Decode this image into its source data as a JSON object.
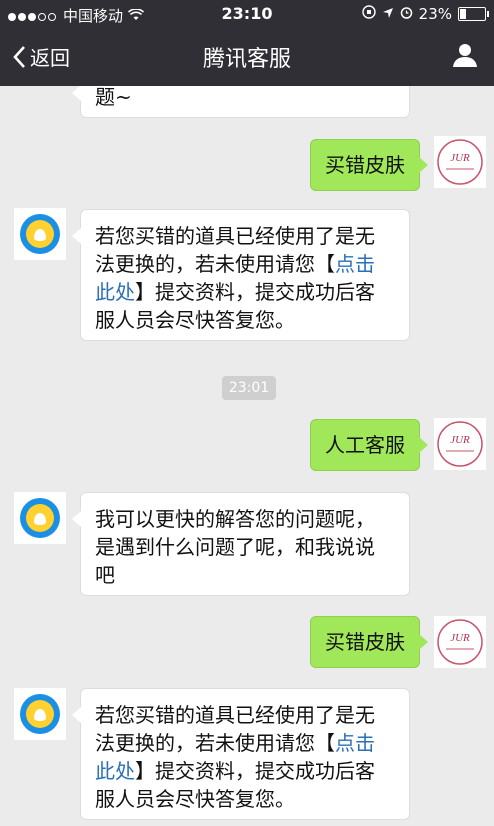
{
  "status_bar": {
    "carrier": "中国移动",
    "time": "23:10",
    "battery_percent": "23%",
    "battery_level": 0.23,
    "icons": [
      "signal-dots-icon",
      "wifi-icon",
      "rotation-lock-icon",
      "location-icon",
      "alarm-icon",
      "battery-icon"
    ]
  },
  "nav": {
    "back_label": "返回",
    "title": "腾讯客服",
    "right_icon": "user-profile-icon"
  },
  "messages": [
    {
      "type": "in",
      "text_lines": [
        "题~"
      ]
    },
    {
      "type": "out",
      "text": "买错皮肤"
    },
    {
      "type": "in",
      "text_lines": [
        "若您买错的道具已经使用了是无",
        "法更换的，若未使用请您【"
      ],
      "link": "点击",
      "link2": "此处",
      "after_link": "】提交资料，提交成功后客",
      "last_line": "服人员会尽快答复您。"
    },
    {
      "type": "time",
      "text": "23:01"
    },
    {
      "type": "out",
      "text": "人工客服"
    },
    {
      "type": "in",
      "text_lines": [
        "我可以更快的解答您的问题呢，",
        "是遇到什么问题了呢，和我说说",
        "吧"
      ]
    },
    {
      "type": "out",
      "text": "买错皮肤"
    },
    {
      "type": "in",
      "text_lines": [
        "若您买错的道具已经使用了是无",
        "法更换的，若未使用请您【"
      ],
      "link": "点击",
      "link2": "此处",
      "after_link": "】提交资料，提交成功后客",
      "last_line": "服人员会尽快答复您。"
    }
  ],
  "avatar_user_text": "JUR",
  "colors": {
    "nav_bg": "#2f2f35",
    "out_bubble": "#a0e75a",
    "link": "#2a6fb8",
    "chat_bg": "#ebebeb"
  }
}
